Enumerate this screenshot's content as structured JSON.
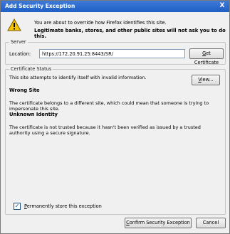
{
  "window": {
    "title": "Add Security Exception",
    "close_glyph": "X"
  },
  "header": {
    "icon": "warning-icon",
    "line1": "You are about to override how Firefox identifies this site.",
    "line2": "Legitimate banks, stores, and other public sites will not ask you to do this."
  },
  "server": {
    "legend": "Server",
    "location_label": "Location:",
    "location_value": "https://172.20.91.25:8443/SR/",
    "get_certificate_label": "Get Certificate"
  },
  "status": {
    "legend": "Certificate Status",
    "intro": "This site attempts to identify itself with invalid information.",
    "view_label": "View...",
    "wrong_site_title": "Wrong Site",
    "wrong_site_text": "The certificate belongs to a different site, which could mean that someone is trying to impersonate this site.",
    "unknown_identity_title": "Unknown Identity",
    "unknown_identity_text": "The certificate is not trusted because it hasn't been verified as issued by a trusted authority using a secure signature."
  },
  "permanent": {
    "label": "Permanently store this exception",
    "checked": true
  },
  "buttons": {
    "confirm": "Confirm Security Exception",
    "cancel": "Cancel"
  },
  "colors": {
    "titlebar": "#2a66cc",
    "warning": "#f5c400"
  }
}
